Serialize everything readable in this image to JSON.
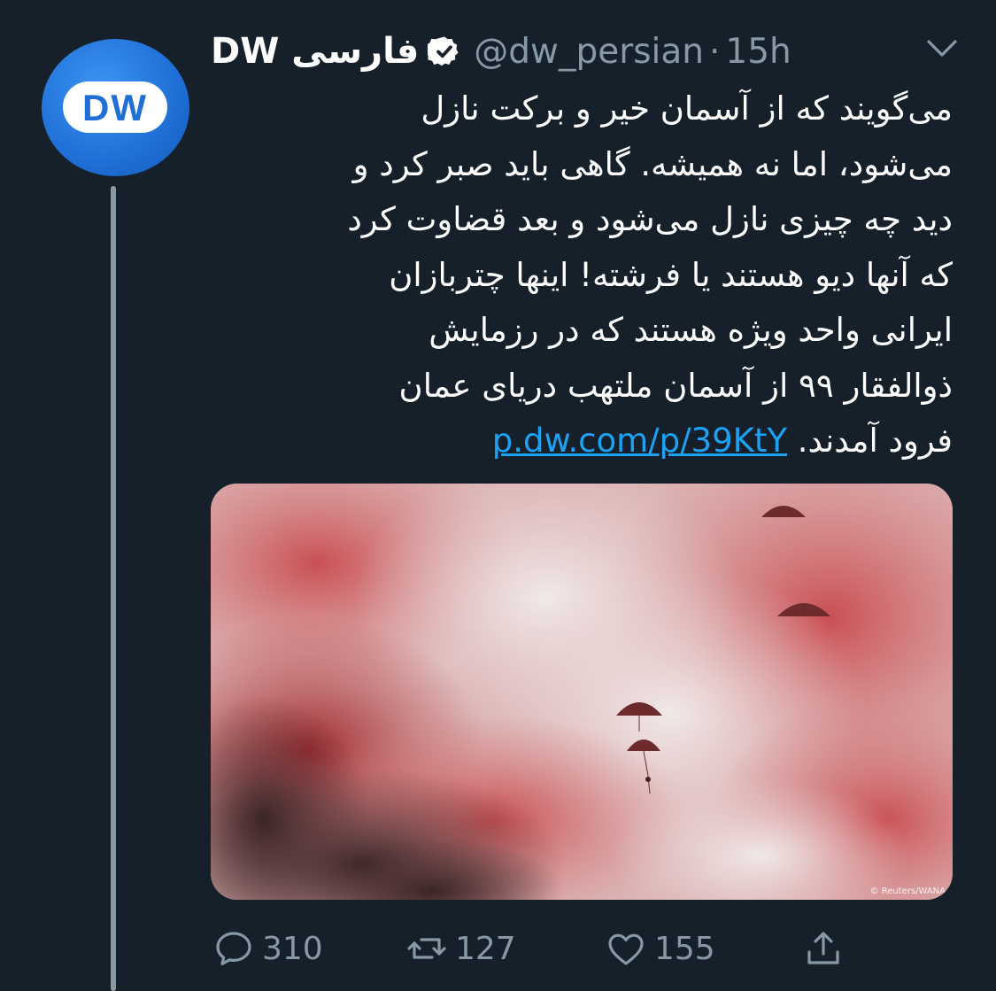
{
  "tweet": {
    "author_name": "DW فارسی",
    "handle": "@dw_persian",
    "separator": "·",
    "time": "15h",
    "avatar": {
      "label": "DW",
      "icon": "dw-logo"
    },
    "text_lines": [
      "می‌گویند که از آسمان خیر و برکت نازل",
      "می‌شود، اما نه همیشه. گاهی باید صبر کرد و",
      "دید چه چیزی نازل می‌شود و بعد قضاوت کرد",
      "که آنها دیو هستند یا فرشته! اینها چتربازان",
      "ایرانی واحد ویژه هستند که در رزمایش",
      "ذوالفقار ۹۹ از آسمان ملتهب دریای عمان"
    ],
    "last_line_text": "فرود آمدند.",
    "link": "p.dw.com/p/39KtY",
    "image": {
      "description_icon": "paratroopers-red-smoke-image",
      "credit": "© Reuters/WANA"
    },
    "actions": {
      "replies": "310",
      "retweets": "127",
      "likes": "155"
    }
  },
  "colors": {
    "background": "#15202b",
    "secondary_text": "#8899a6",
    "link": "#1da1f2",
    "avatar_blue": "#1f6fd6"
  }
}
